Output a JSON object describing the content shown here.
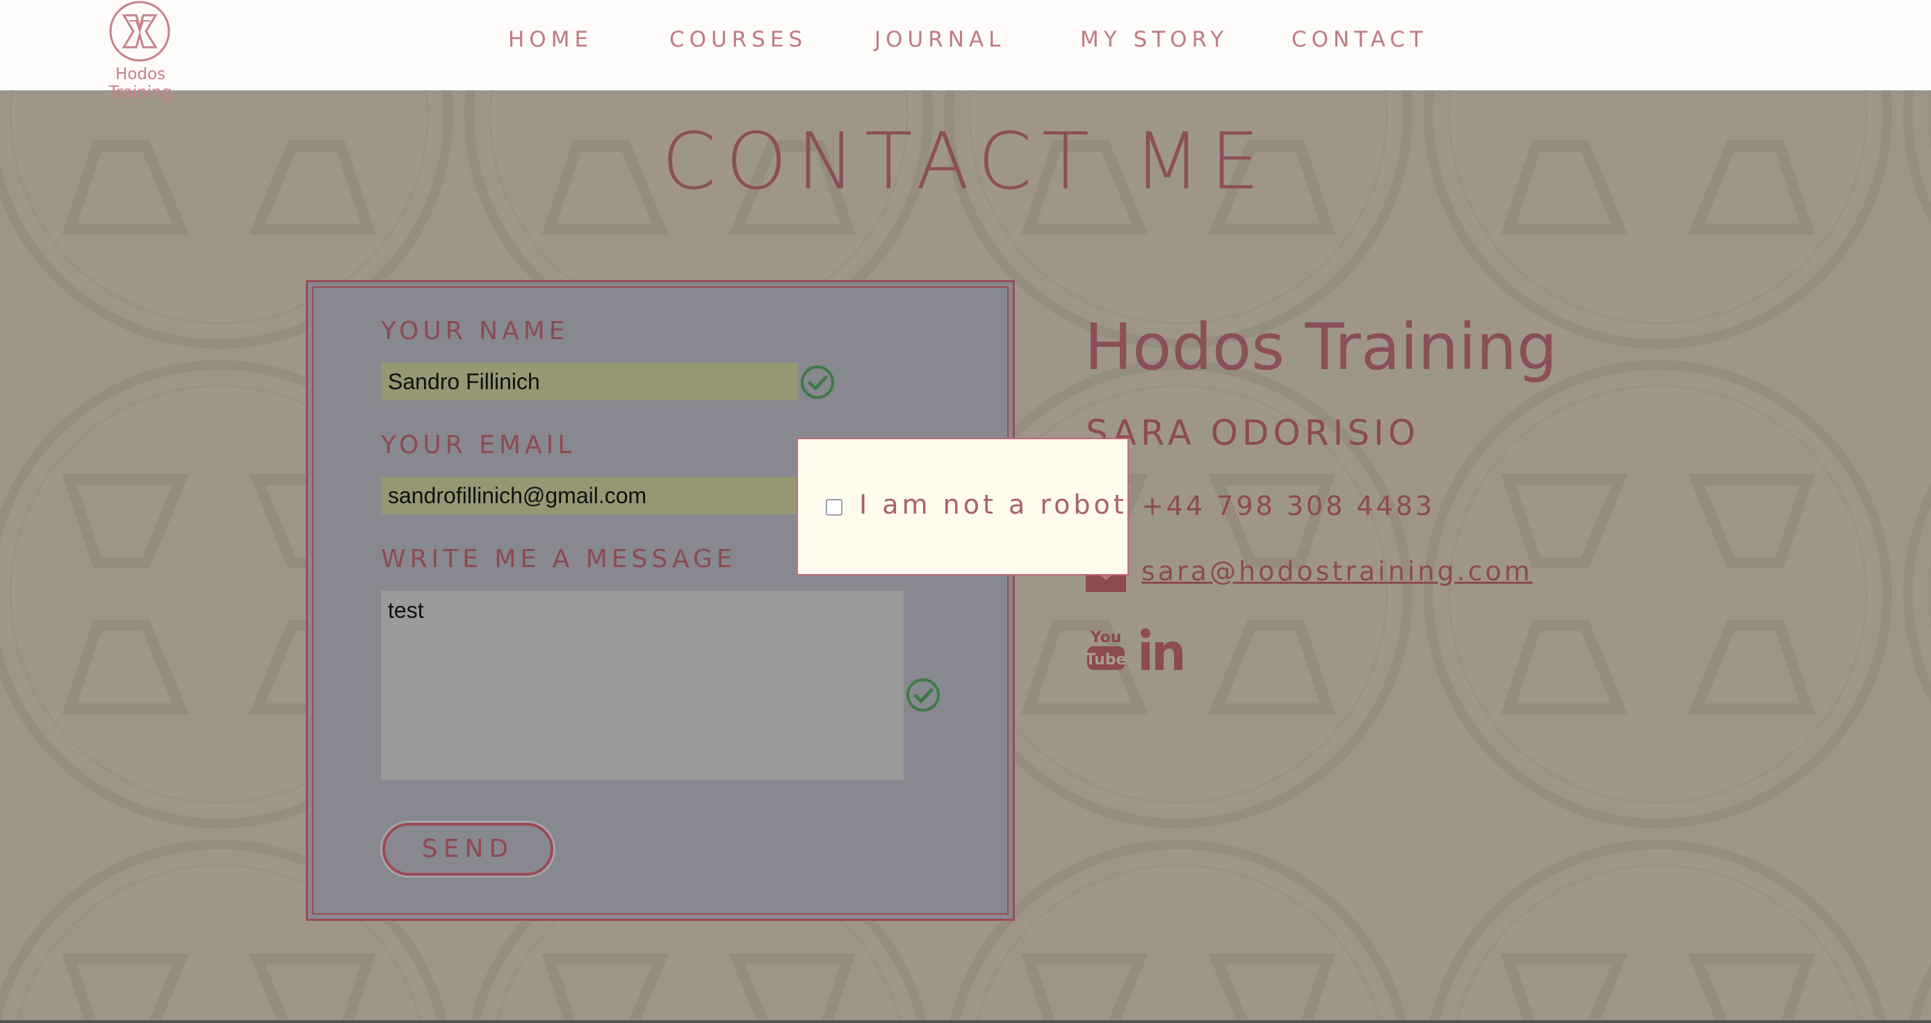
{
  "brand": {
    "logo_text": "Hodos Training",
    "accent_color": "#8c4a53",
    "header_background": "#fdfcfb",
    "page_background": "#9f968a"
  },
  "nav": {
    "items": [
      {
        "label": "HOME"
      },
      {
        "label": "COURSES"
      },
      {
        "label": "JOURNAL"
      },
      {
        "label": "MY STORY"
      },
      {
        "label": "CONTACT"
      }
    ]
  },
  "page": {
    "title": "CONTACT ME"
  },
  "form": {
    "name_label": "YOUR NAME",
    "name_value": "Sandro Fillinich",
    "email_label": "YOUR EMAIL",
    "email_value": "sandrofillinich@gmail.com",
    "message_label": "WRITE ME A MESSAGE",
    "message_value": "test",
    "send_label": "SEND",
    "valid_icon": "check-circle-icon"
  },
  "contact": {
    "company": "Hodos Training",
    "person": "SARA ODORISIO",
    "phone": "+44 798 308 4483",
    "email": "sara@hodostraining.com",
    "social": [
      {
        "name": "YouTube",
        "icon": "youtube-icon",
        "text": "You Tube"
      },
      {
        "name": "LinkedIn",
        "icon": "linkedin-icon",
        "text": "in"
      }
    ]
  },
  "captcha": {
    "label": "I am not a robot",
    "checked": false
  }
}
